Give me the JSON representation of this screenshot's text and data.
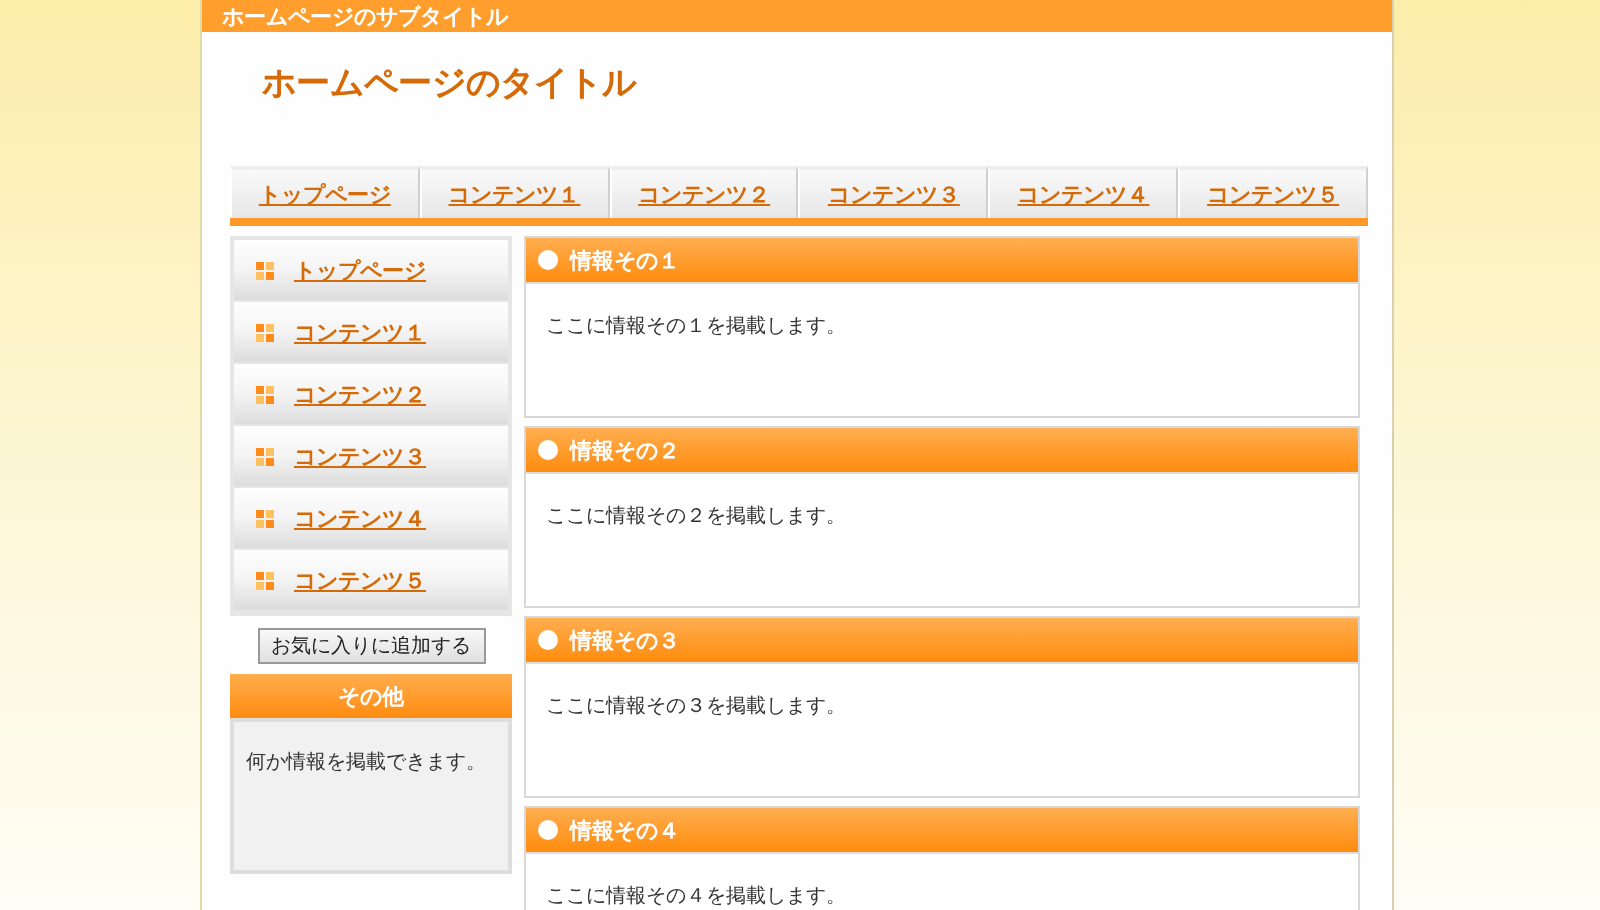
{
  "header": {
    "subtitle": "ホームページのサブタイトル",
    "title": "ホームページのタイトル"
  },
  "nav": [
    "トップページ",
    "コンテンツ１",
    "コンテンツ２",
    "コンテンツ３",
    "コンテンツ４",
    "コンテンツ５"
  ],
  "sidebar": {
    "items": [
      "トップページ",
      "コンテンツ１",
      "コンテンツ２",
      "コンテンツ３",
      "コンテンツ４",
      "コンテンツ５"
    ],
    "favorite_button": "お気に入りに追加する",
    "other": {
      "heading": "その他",
      "text": "何か情報を掲載できます。"
    }
  },
  "sections": [
    {
      "heading": "情報その１",
      "text": "ここに情報その１を掲載します。"
    },
    {
      "heading": "情報その２",
      "text": "ここに情報その２を掲載します。"
    },
    {
      "heading": "情報その３",
      "text": "ここに情報その３を掲載します。"
    },
    {
      "heading": "情報その４",
      "text": "ここに情報その４を掲載します。"
    }
  ]
}
